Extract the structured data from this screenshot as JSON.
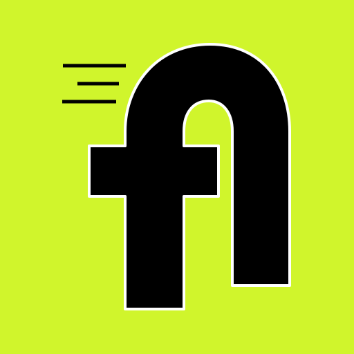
{
  "icon": {
    "name": "fi-logo-app-icon",
    "colors": {
      "background": "#d0f52c",
      "glyph": "#000000",
      "outline": "#ffffff",
      "speed_lines": "#000000"
    },
    "elements": [
      "speed-lines",
      "fi-ligature-glyph"
    ]
  }
}
